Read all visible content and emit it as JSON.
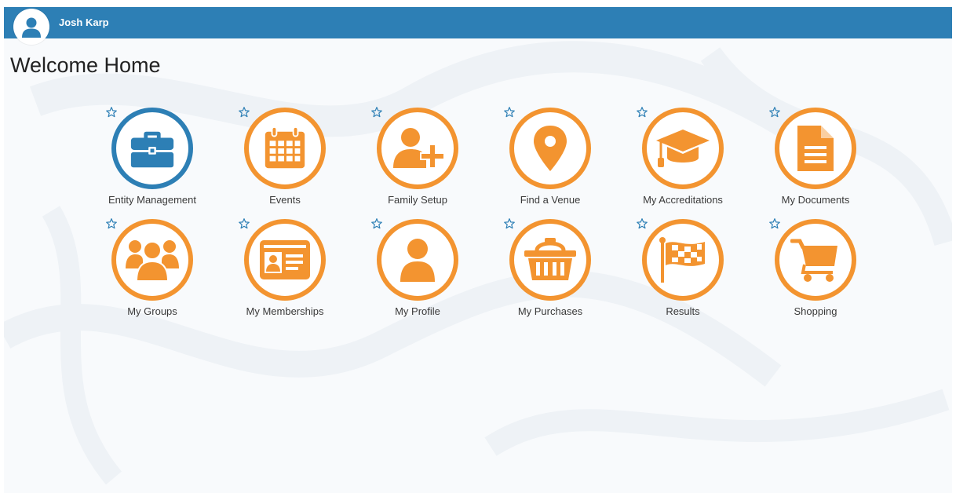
{
  "user": {
    "name": "Josh Karp",
    "avatar_icon": "user-avatar-icon"
  },
  "page": {
    "title": "Welcome Home"
  },
  "colors": {
    "header": "#2d7fb5",
    "accent": "#f39430",
    "active": "#2d7fb5"
  },
  "tiles": [
    {
      "label": "Entity Management",
      "icon": "briefcase-icon",
      "highlighted": true
    },
    {
      "label": "Events",
      "icon": "calendar-icon"
    },
    {
      "label": "Family Setup",
      "icon": "add-user-icon"
    },
    {
      "label": "Find a Venue",
      "icon": "map-pin-icon"
    },
    {
      "label": "My Accreditations",
      "icon": "graduation-cap-icon"
    },
    {
      "label": "My Documents",
      "icon": "document-icon"
    },
    {
      "label": "My Groups",
      "icon": "group-icon"
    },
    {
      "label": "My Memberships",
      "icon": "id-card-icon"
    },
    {
      "label": "My Profile",
      "icon": "user-icon"
    },
    {
      "label": "My Purchases",
      "icon": "basket-icon"
    },
    {
      "label": "Results",
      "icon": "checkered-flag-icon"
    },
    {
      "label": "Shopping",
      "icon": "shopping-cart-icon"
    }
  ]
}
